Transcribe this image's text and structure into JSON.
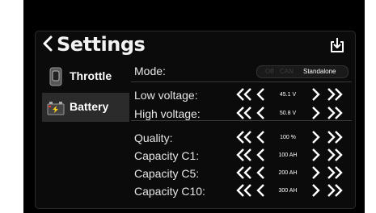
{
  "header": {
    "title": "Settings"
  },
  "sidebar": {
    "items": [
      {
        "label": "Throttle",
        "icon": "throttle-icon"
      },
      {
        "label": "Battery",
        "icon": "battery-icon",
        "active": true
      }
    ]
  },
  "mode": {
    "label": "Mode:",
    "options": [
      "Off",
      "CAN",
      "Standalone"
    ],
    "selected": "Standalone"
  },
  "settings": [
    {
      "key": "low_voltage",
      "label": "Low voltage:",
      "value": "45.1 V"
    },
    {
      "key": "high_voltage",
      "label": "High voltage:",
      "value": "50.8 V"
    },
    {
      "key": "quality",
      "label": "Quality:",
      "value": "100 %"
    },
    {
      "key": "capacity_c1",
      "label": "Capacity C1:",
      "value": "100 AH"
    },
    {
      "key": "capacity_c5",
      "label": "Capacity C5:",
      "value": "200 AH"
    },
    {
      "key": "capacity_c10",
      "label": "Capacity C10:",
      "value": "300 AH"
    }
  ],
  "colors": {
    "background": "#000000",
    "panel": "#0b0b0b",
    "active_item": "#2b2b2b",
    "text": "#ffffff"
  }
}
